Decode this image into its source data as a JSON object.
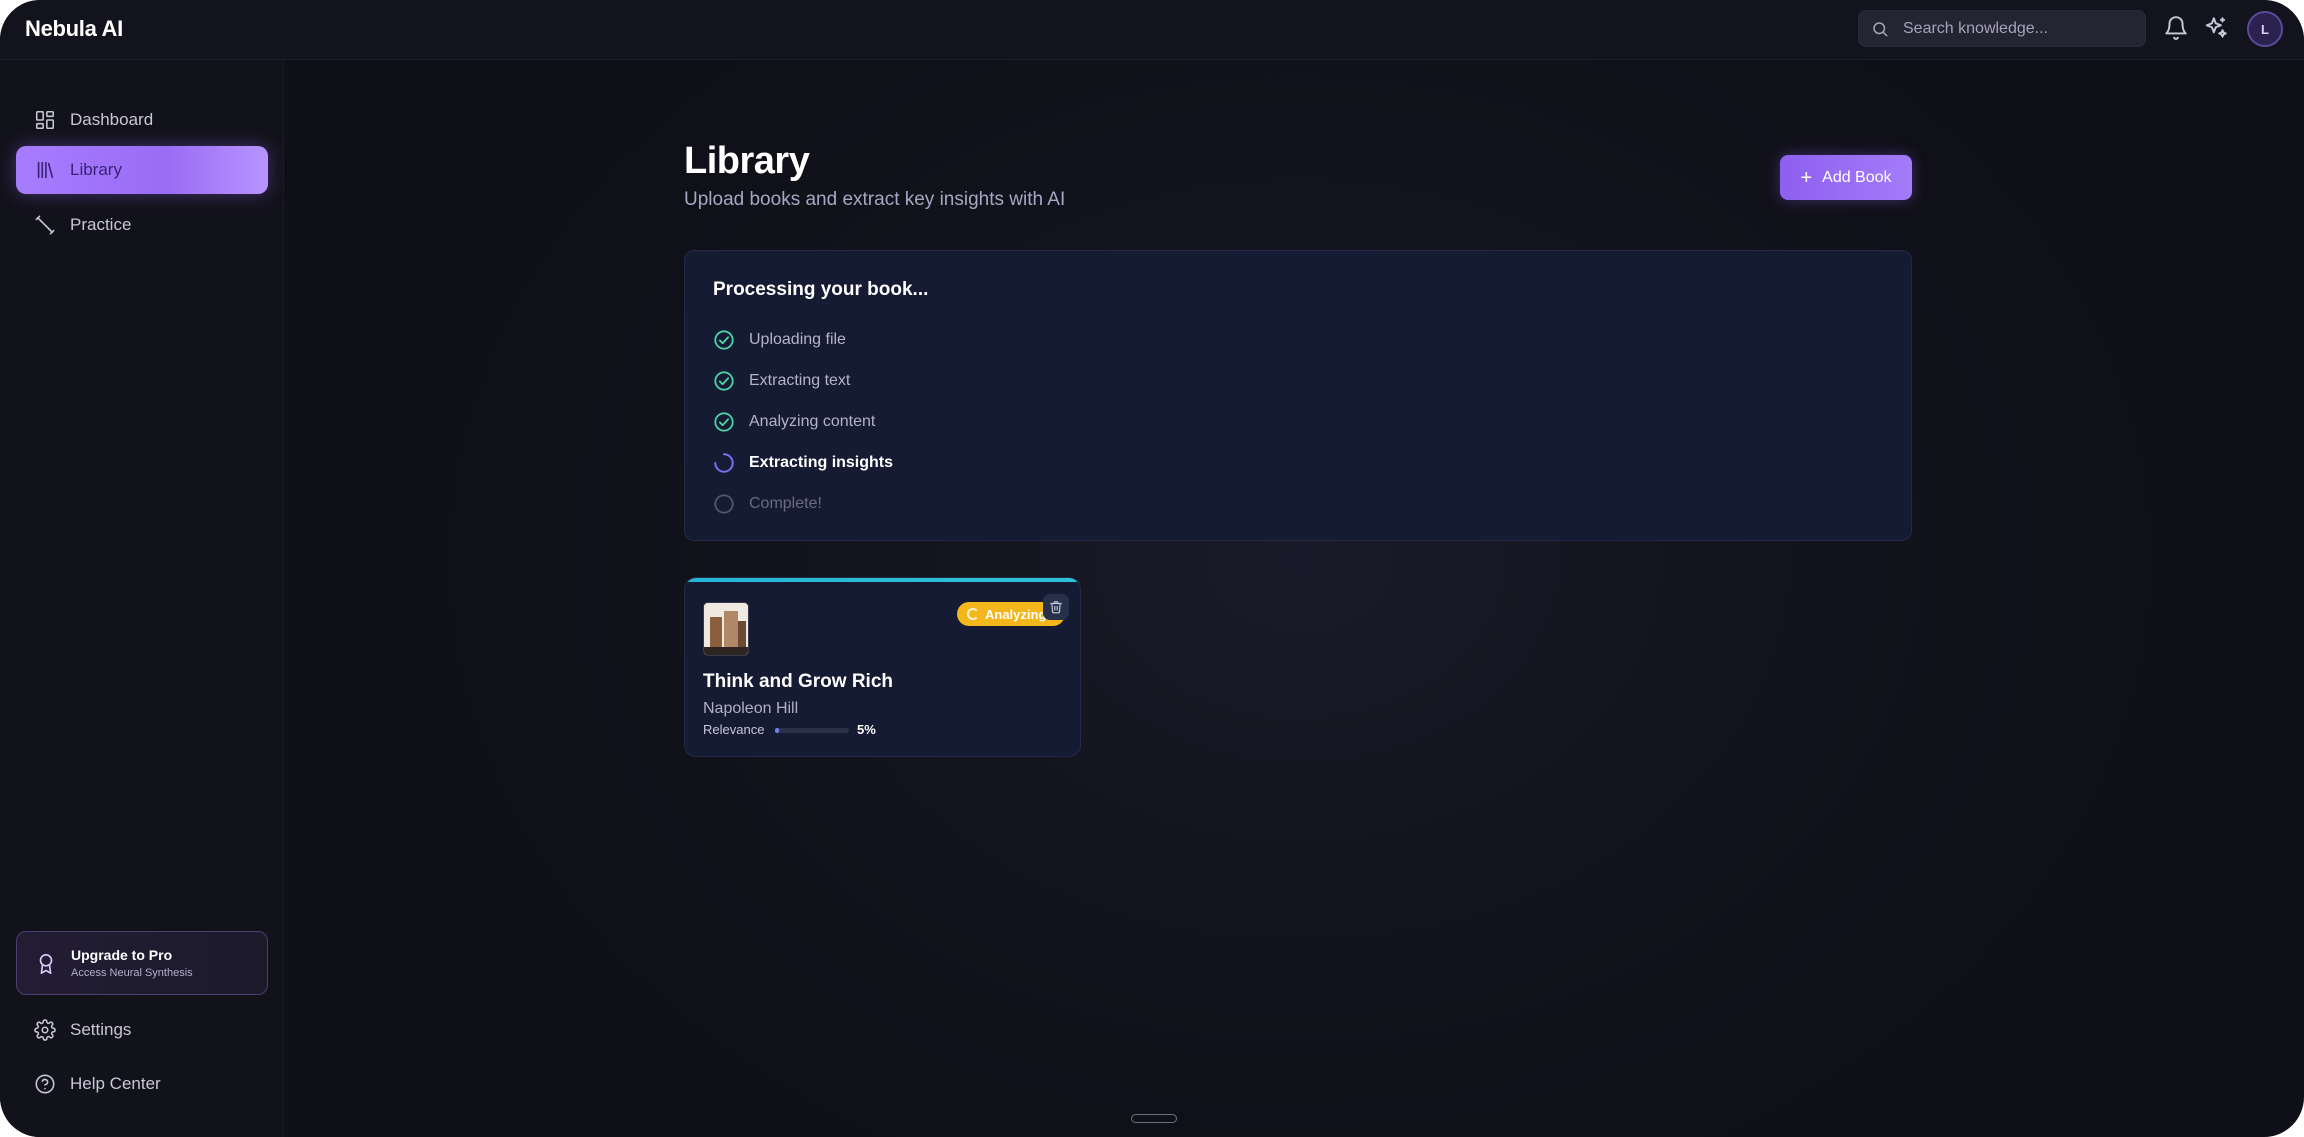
{
  "app": {
    "name": "Nebula AI"
  },
  "header": {
    "search_placeholder": "Search knowledge...",
    "avatar_initial": "L"
  },
  "sidebar": {
    "items": [
      {
        "label": "Dashboard",
        "icon": "dashboard-grid-icon",
        "active": false
      },
      {
        "label": "Library",
        "icon": "library-books-icon",
        "active": true
      },
      {
        "label": "Practice",
        "icon": "dumbbell-icon",
        "active": false
      }
    ],
    "upgrade": {
      "title": "Upgrade to Pro",
      "subtitle": "Access Neural Synthesis"
    },
    "bottom_items": [
      {
        "label": "Settings",
        "icon": "gear-icon"
      },
      {
        "label": "Help Center",
        "icon": "help-circle-icon"
      }
    ]
  },
  "main": {
    "title": "Library",
    "subtitle": "Upload books and extract key insights with AI",
    "add_button_label": "Add Book",
    "processing": {
      "title": "Processing your book...",
      "steps": [
        {
          "label": "Uploading file",
          "status": "done"
        },
        {
          "label": "Extracting text",
          "status": "done"
        },
        {
          "label": "Analyzing content",
          "status": "done"
        },
        {
          "label": "Extracting insights",
          "status": "in-progress"
        },
        {
          "label": "Complete!",
          "status": "pending"
        }
      ]
    },
    "books": [
      {
        "title": "Think and Grow Rich",
        "author": "Napoleon Hill",
        "status": "Analyzing",
        "relevance_label": "Relevance",
        "relevance_percent": 5,
        "relevance_text": "5%"
      }
    ]
  },
  "colors": {
    "accent": "#9a6cf4",
    "done_green": "#4fd1a5",
    "progress_purple": "#7c6cf0",
    "badge_yellow": "#f3b71c",
    "card_top_strip": "#24b6d6"
  }
}
